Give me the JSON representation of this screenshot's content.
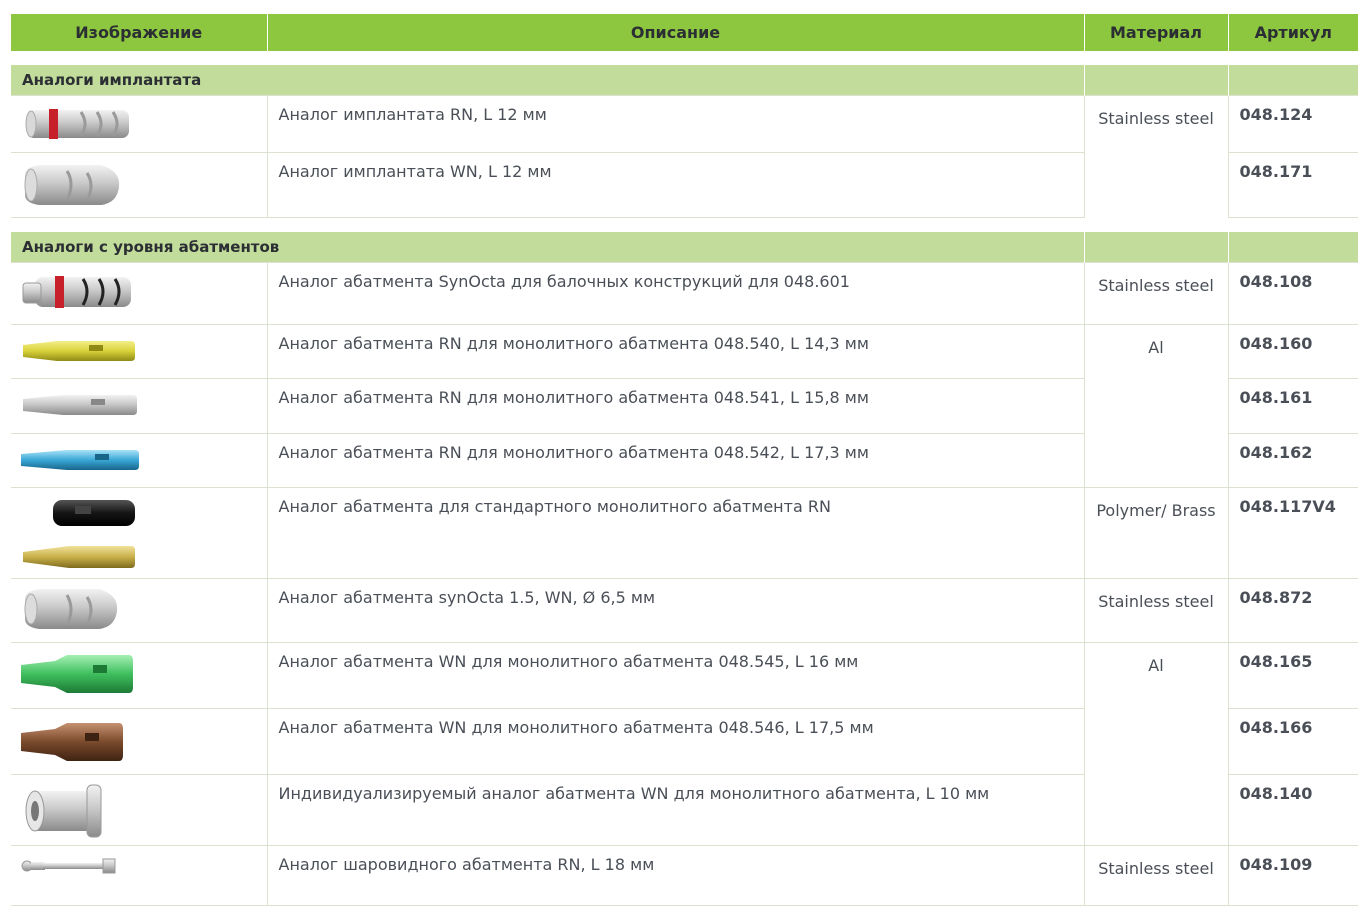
{
  "header": {
    "image": "Изображение",
    "description": "Описание",
    "material": "Материал",
    "article": "Артикул"
  },
  "sections": [
    {
      "title": "Аналоги имплантата",
      "rows": [
        {
          "icon": "implant-analog-rn-icon",
          "description": "Аналог имплантата RN, L 12 мм",
          "material": "Stainless steel",
          "article": "048.124"
        },
        {
          "icon": "implant-analog-wn-icon",
          "description": "Аналог имплантата WN, L 12 мм",
          "material": "",
          "article": "048.171"
        }
      ]
    },
    {
      "title": "Аналоги с уровня абатментов",
      "rows": [
        {
          "icon": "synocta-analog-icon",
          "description": "Аналог абатмента SynOcta для балочных конструкций для 048.601",
          "material": "Stainless steel",
          "article": "048.108"
        },
        {
          "icon": "yellow-analog-icon",
          "description": "Аналог абатмента RN для монолитного абатмента 048.540, L 14,3 мм",
          "material": "Al",
          "article": "048.160"
        },
        {
          "icon": "grey-analog-icon",
          "description": "Аналог абатмента RN для монолитного абатмента 048.541, L 15,8 мм",
          "material": "",
          "article": "048.161"
        },
        {
          "icon": "blue-analog-icon",
          "description": "Аналог абатмента RN для монолитного абатмента 048.542, L 17,3 мм",
          "material": "",
          "article": "048.162"
        },
        {
          "icon": "polymer-brass-analog-icon",
          "description": "Аналог абатмента для стандартного монолитного абатмента RN",
          "material": "Polymer/ Brass",
          "article": "048.117V4"
        },
        {
          "icon": "synocta-wn-analog-icon",
          "description": "Аналог абатмента synOcta 1.5, WN, Ø 6,5 мм",
          "material": "Stainless steel",
          "article": "048.872"
        },
        {
          "icon": "green-analog-icon",
          "description": "Аналог абатмента WN для монолитного абатмента 048.545, L 16 мм",
          "material": "Al",
          "article": "048.165"
        },
        {
          "icon": "brown-analog-icon",
          "description": "Аналог абатмента WN для монолитного абатмента 048.546, L 17,5 мм",
          "material": "",
          "article": "048.166"
        },
        {
          "icon": "custom-analog-icon",
          "description": "Индивидуализируемый аналог абатмента WN для монолитного абатмента, L 10 мм",
          "material": "",
          "article": "048.140"
        },
        {
          "icon": "ball-analog-icon",
          "description": "Аналог шаровидного абатмента RN, L 18 мм",
          "material": "Stainless steel",
          "article": "048.109"
        }
      ]
    }
  ],
  "colors": {
    "header": "#8dc63f",
    "section": "#c2dc9b",
    "yellow": "#d9d23a",
    "blue": "#3aa7d6",
    "green": "#3fbf5e",
    "brown": "#7a4a2c",
    "red": "#c8202a"
  }
}
